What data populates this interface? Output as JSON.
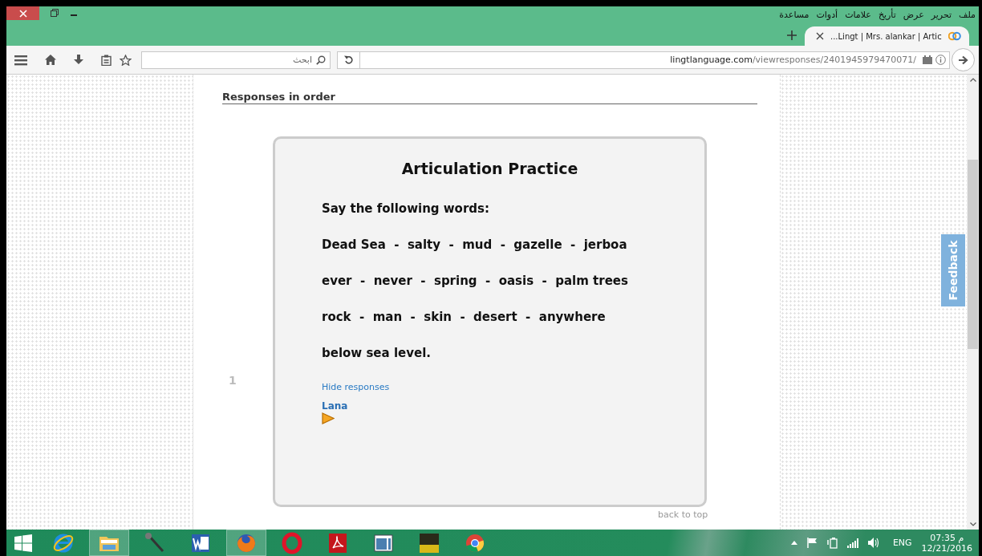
{
  "window": {
    "menu": [
      "ملف",
      "تحرير",
      "عرض",
      "تأريخ",
      "علامات",
      "أدوات",
      "مساعدة"
    ],
    "tabs": [
      {
        "title": "...Lingt | Mrs. alankar | Artic",
        "selected": true
      }
    ]
  },
  "toolbar": {
    "search": {
      "placeholder": "ابحث"
    },
    "address": {
      "domain": "lingtlanguage.com",
      "path": "/viewresponses/2401945979470071/"
    }
  },
  "page": {
    "heading": "Responses in order",
    "item_number": "1",
    "card": {
      "title": "Articulation Practice",
      "instruction": "Say the following words:",
      "lines": [
        "Dead Sea  -  salty  -  mud  -  gazelle  -  jerboa",
        "ever  -  never  -  spring  -  oasis  -  palm trees",
        "rock  -  man  -  skin  -  desert  -  anywhere",
        "below sea level."
      ],
      "hide_link": "Hide responses",
      "responder": "Lana"
    },
    "back_to_top": "back to top",
    "feedback": "Feedback"
  },
  "taskbar": {
    "apps": [
      {
        "kind": "ie",
        "selected": false
      },
      {
        "kind": "folder",
        "selected": true
      },
      {
        "kind": "mic",
        "selected": false
      },
      {
        "kind": "word",
        "selected": false
      },
      {
        "kind": "firefox",
        "selected": true
      },
      {
        "kind": "opera",
        "selected": false
      },
      {
        "kind": "pdf",
        "selected": false
      },
      {
        "kind": "window",
        "selected": false
      },
      {
        "kind": "game",
        "selected": false
      },
      {
        "kind": "chrome",
        "selected": false
      }
    ],
    "language": "ENG",
    "time": "07:35 م",
    "date": "12/21/2016"
  }
}
